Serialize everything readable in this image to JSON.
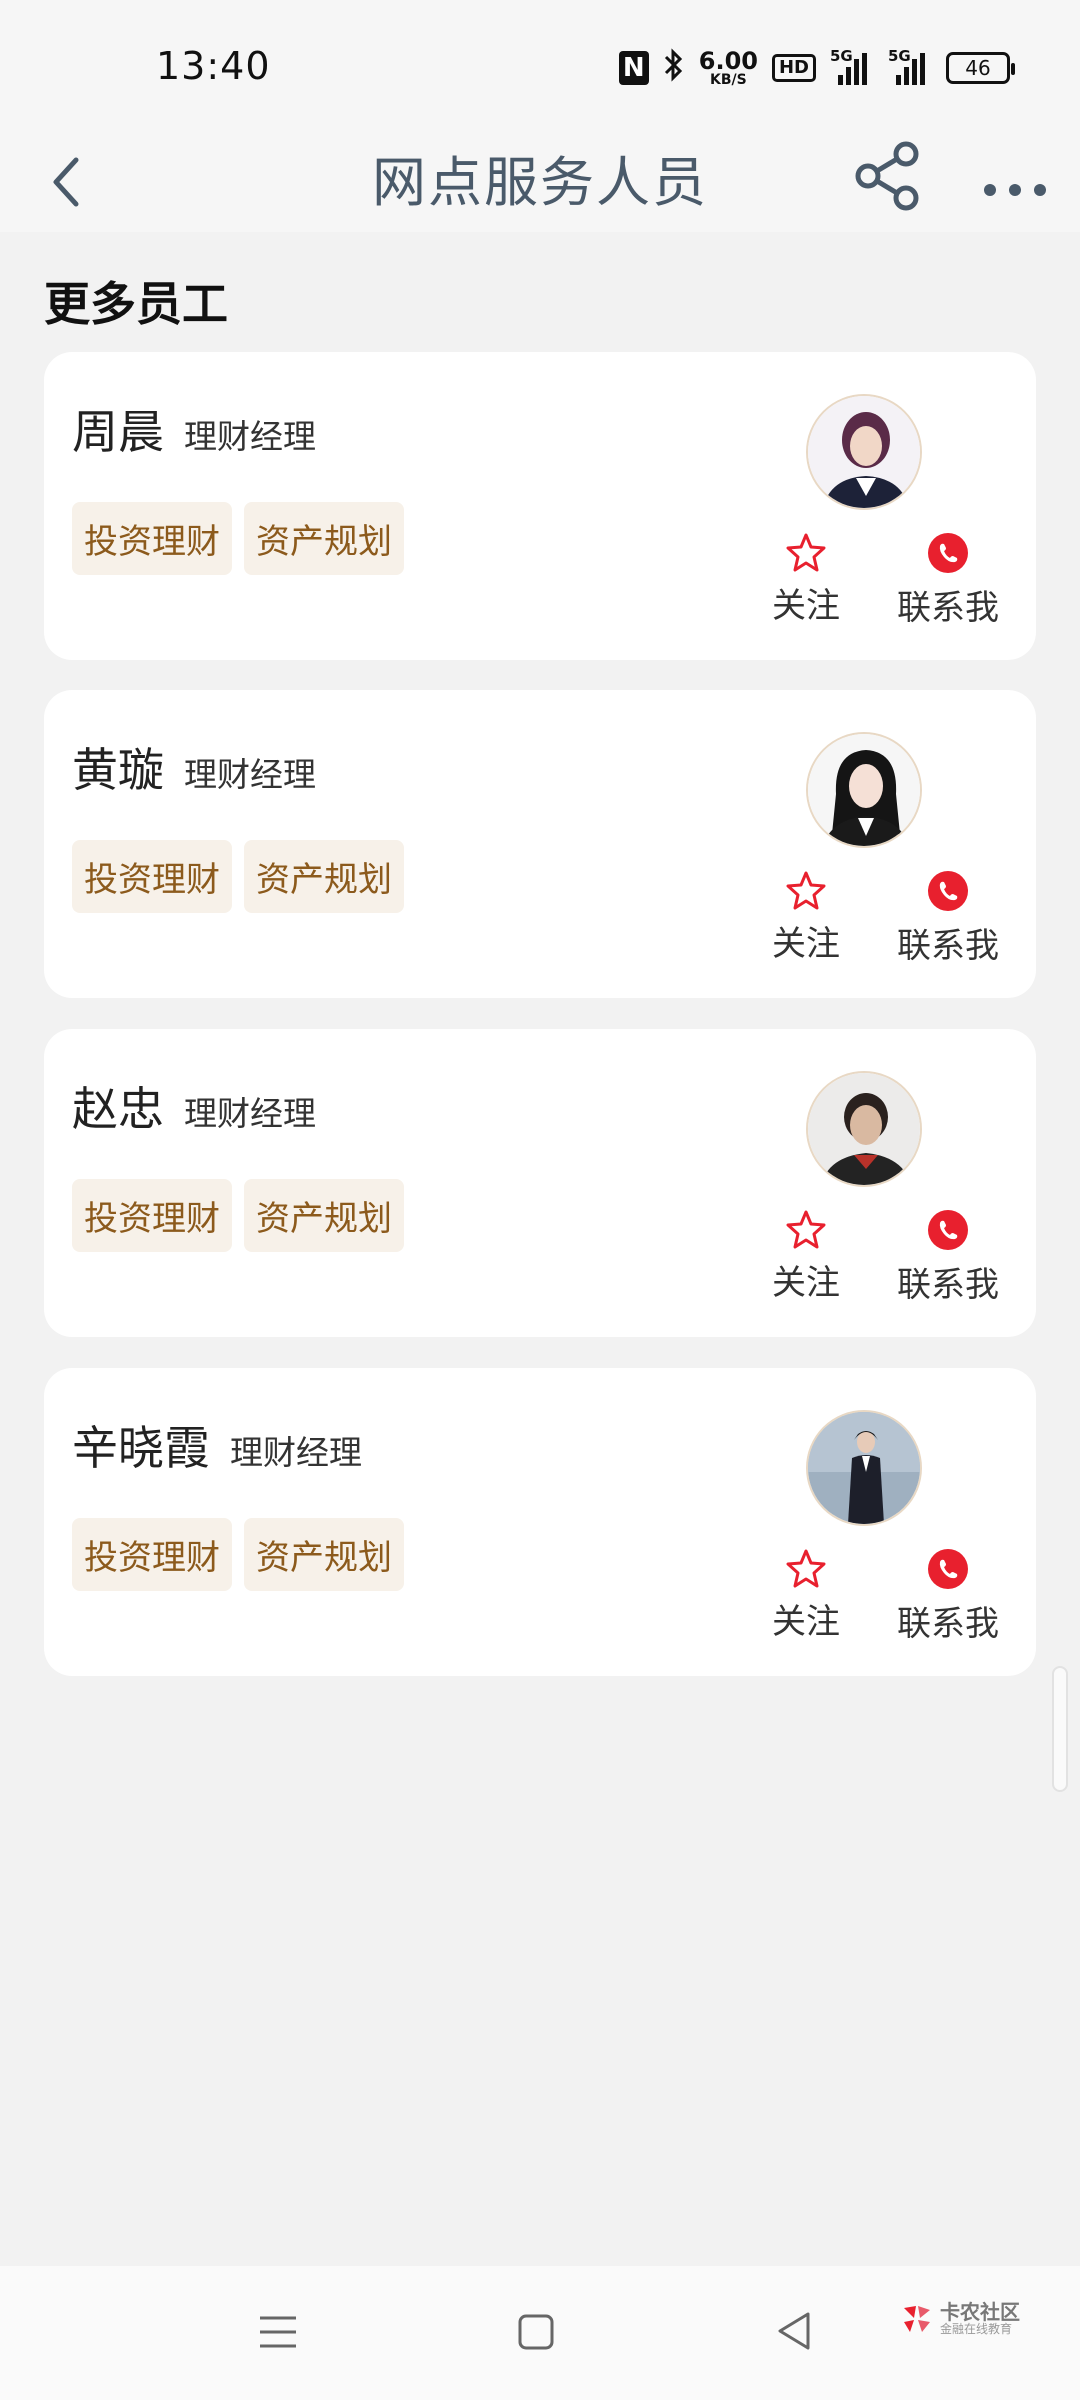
{
  "status_bar": {
    "time": "13:40",
    "speed_value": "6.00",
    "speed_unit": "KB/S",
    "hd_label": "HD",
    "signal1_label": "5G",
    "signal2_label": "5G",
    "battery": "46",
    "icons": [
      "nfc-icon",
      "bluetooth-icon",
      "hd-icon",
      "signal-icon",
      "battery-icon"
    ]
  },
  "header": {
    "title": "网点服务人员",
    "icons": [
      "back-icon",
      "share-icon",
      "more-icon"
    ]
  },
  "section": {
    "title": "更多员工"
  },
  "staff": [
    {
      "name": "周晨",
      "role": "理财经理",
      "tags": [
        "投资理财",
        "资产规划"
      ],
      "follow_label": "关注",
      "contact_label": "联系我"
    },
    {
      "name": "黄璇",
      "role": "理财经理",
      "tags": [
        "投资理财",
        "资产规划"
      ],
      "follow_label": "关注",
      "contact_label": "联系我"
    },
    {
      "name": "赵忠",
      "role": "理财经理",
      "tags": [
        "投资理财",
        "资产规划"
      ],
      "follow_label": "关注",
      "contact_label": "联系我"
    },
    {
      "name": "辛晓霞",
      "role": "理财经理",
      "tags": [
        "投资理财",
        "资产规划"
      ],
      "follow_label": "关注",
      "contact_label": "联系我"
    }
  ],
  "watermark": {
    "main": "卡农社区",
    "sub": "金融在线教育"
  },
  "colors": {
    "accent_red": "#e8202e",
    "tag_text": "#8c5a1c",
    "tag_bg": "#f7f1e9",
    "title_text": "#4a5a6a"
  }
}
